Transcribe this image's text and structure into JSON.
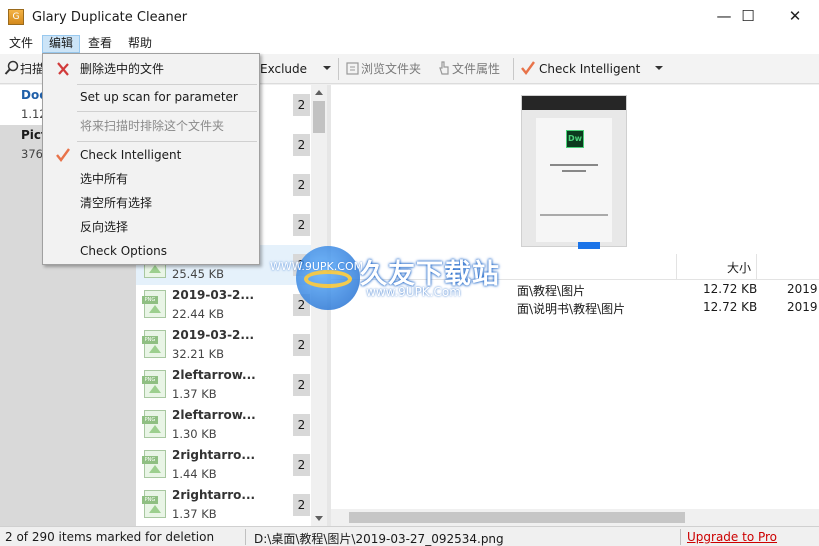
{
  "window": {
    "title": "Glary Duplicate Cleaner",
    "app_icon_glyph": "G",
    "minimize_glyph": "—",
    "maximize_glyph": "☐",
    "close_glyph": "✕"
  },
  "menubar": {
    "items": [
      "文件",
      "编辑",
      "查看",
      "帮助"
    ],
    "active_index": 1
  },
  "toolbar": {
    "scan_label": "扫描",
    "exclude_label": "Exclude",
    "browse_folder_label": "浏览文件夹",
    "file_properties_label": "文件属性",
    "check_intelligent_label": "Check Intelligent"
  },
  "categories": [
    {
      "name": "Doc",
      "size": "1.12",
      "selected": true
    },
    {
      "name": "Pict",
      "size": "376",
      "selected": false
    }
  ],
  "file_rows": [
    {
      "name": "",
      "size": "",
      "count": "2"
    },
    {
      "name": "",
      "size": "",
      "count": "2"
    },
    {
      "name": "",
      "size": "",
      "count": "2"
    },
    {
      "name": "",
      "size": "",
      "count": "2"
    },
    {
      "name": "",
      "size": "25.45 KB",
      "count": "2"
    },
    {
      "name": "2019-03-2...",
      "size": "22.44 KB",
      "count": "2"
    },
    {
      "name": "2019-03-2...",
      "size": "32.21 KB",
      "count": "2"
    },
    {
      "name": "2leftarrow...",
      "size": "1.37 KB",
      "count": "2"
    },
    {
      "name": "2leftarrow...",
      "size": "1.30 KB",
      "count": "2"
    },
    {
      "name": "2rightarro...",
      "size": "1.44 KB",
      "count": "2"
    },
    {
      "name": "2rightarro...",
      "size": "1.37 KB",
      "count": "2"
    }
  ],
  "details": {
    "size_header": "大小",
    "rows": [
      {
        "path": "面\\教程\\图片",
        "size": "12.72 KB",
        "date": "2019"
      },
      {
        "path": "面\\说明书\\教程\\图片",
        "size": "12.72 KB",
        "date": "2019"
      }
    ]
  },
  "edit_menu": {
    "items": [
      {
        "label": "删除选中的文件",
        "icon": "delete-x-icon",
        "disabled": false
      },
      {
        "label": "Set up scan for parameter",
        "disabled": false
      },
      {
        "label": "将来扫描时排除这个文件夹",
        "disabled": true
      },
      {
        "label": "Check Intelligent",
        "icon": "checkmark-icon",
        "disabled": false
      },
      {
        "label": "选中所有",
        "disabled": false
      },
      {
        "label": "清空所有选择",
        "disabled": false
      },
      {
        "label": "反向选择",
        "disabled": false
      },
      {
        "label": "Check Options",
        "disabled": false
      }
    ]
  },
  "statusbar": {
    "marked": "2 of 290 items marked for deletion",
    "current_path": "D:\\桌面\\教程\\图片\\2019-03-27_092534.png",
    "upgrade_label": "Upgrade to Pro"
  },
  "watermark": {
    "title": "久友下载站",
    "url": "www.9UPK.Com",
    "url_small": "WWW.9UPK.COM"
  },
  "colors": {
    "accent_check": "#e8734a",
    "delete_x": "#d13b3b",
    "upgrade_link": "#cc0000",
    "selection": "#cce4f7"
  }
}
